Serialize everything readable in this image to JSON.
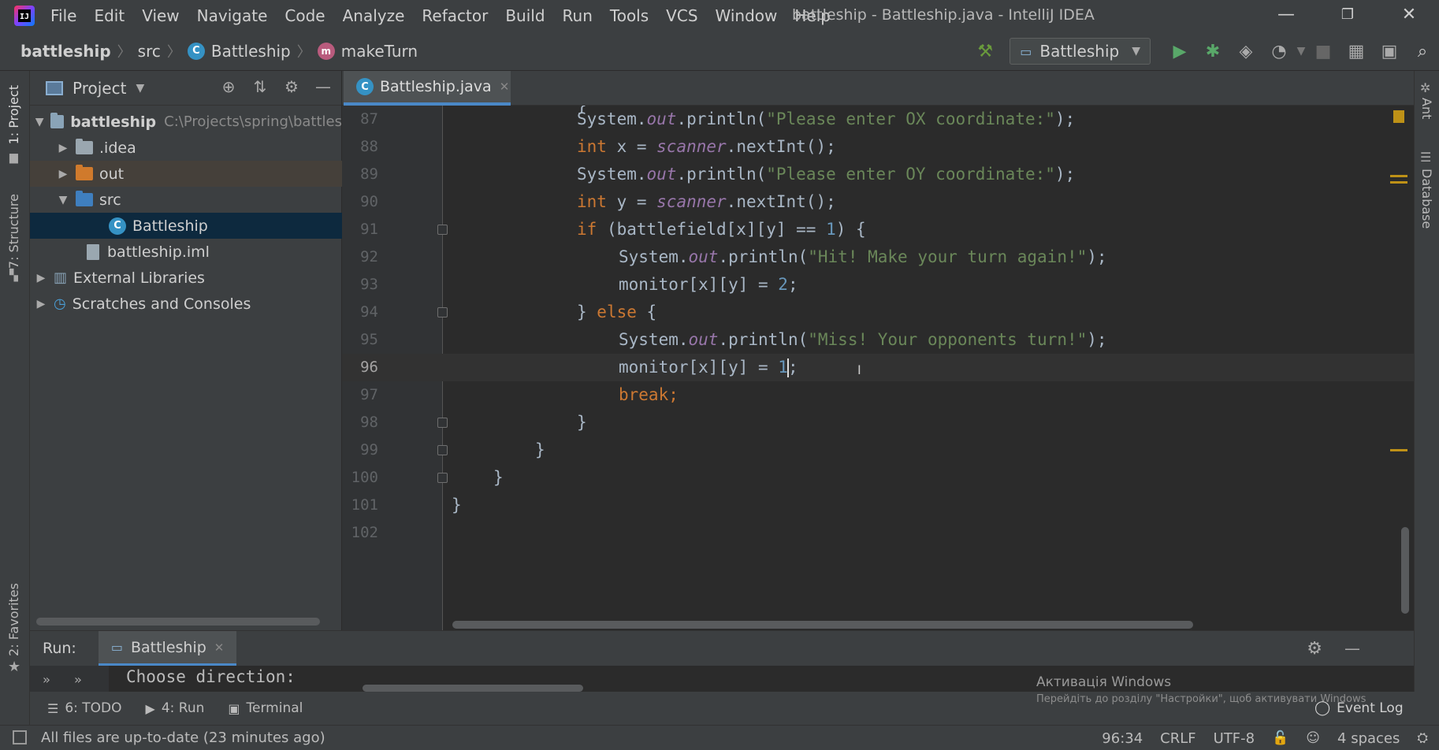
{
  "window": {
    "title": "battleship - Battleship.java - IntelliJ IDEA"
  },
  "menu": [
    "File",
    "Edit",
    "View",
    "Navigate",
    "Code",
    "Analyze",
    "Refactor",
    "Build",
    "Run",
    "Tools",
    "VCS",
    "Window",
    "Help"
  ],
  "breadcrumb": {
    "project": "battleship",
    "folder": "src",
    "class": "Battleship",
    "method": "makeTurn"
  },
  "toolbar": {
    "run_config": "Battleship"
  },
  "side_tabs": {
    "project": "1: Project",
    "structure": "7: Structure",
    "favorites": "2: Favorites",
    "ant": "Ant",
    "database": "Database"
  },
  "project_panel": {
    "title": "Project",
    "items": [
      {
        "label": "battleship",
        "hint": "C:\\Projects\\spring\\battles"
      },
      {
        "label": ".idea"
      },
      {
        "label": "out"
      },
      {
        "label": "src"
      },
      {
        "label": "Battleship"
      },
      {
        "label": "battleship.iml"
      },
      {
        "label": "External Libraries"
      },
      {
        "label": "Scratches and Consoles"
      }
    ]
  },
  "editor": {
    "tab": "Battleship.java",
    "line_numbers": [
      "87",
      "88",
      "89",
      "90",
      "91",
      "92",
      "93",
      "94",
      "95",
      "96",
      "97",
      "98",
      "99",
      "100",
      "101",
      "102"
    ],
    "strings": {
      "ox": "\"Please enter OX coordinate:\"",
      "oy": "\"Please enter OY coordinate:\"",
      "hit": "\"Hit! Make your turn again!\"",
      "miss": "\"Miss! Your opponents turn!\""
    }
  },
  "run_panel": {
    "label": "Run:",
    "tab": "Battleship",
    "console_text": "Choose direction:"
  },
  "bottom_tools": {
    "todo": "6: TODO",
    "run": "4: Run",
    "terminal": "Terminal",
    "event_log": "Event Log"
  },
  "activation": {
    "title": "Активація Windows",
    "subtitle": "Перейдіть до розділу \"Настройки\", щоб активувати Windows"
  },
  "status": {
    "message": "All files are up-to-date (23 minutes ago)",
    "position": "96:34",
    "line_sep": "CRLF",
    "encoding": "UTF-8",
    "indent": "4 spaces"
  }
}
